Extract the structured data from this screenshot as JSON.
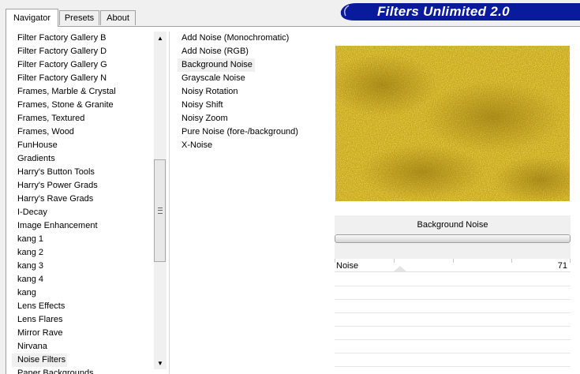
{
  "tabs": [
    {
      "label": "Navigator",
      "active": true
    },
    {
      "label": "Presets",
      "active": false
    },
    {
      "label": "About",
      "active": false
    }
  ],
  "banner": {
    "title": "Filters Unlimited 2.0",
    "color": "#0a1a9c"
  },
  "categories": [
    "Filter Factory Gallery B",
    "Filter Factory Gallery D",
    "Filter Factory Gallery G",
    "Filter Factory Gallery N",
    "Frames, Marble & Crystal",
    "Frames, Stone & Granite",
    "Frames, Textured",
    "Frames, Wood",
    "FunHouse",
    "Gradients",
    "Harry's Button Tools",
    "Harry's Power Grads",
    "Harry's Rave Grads",
    "I-Decay",
    "Image Enhancement",
    "kang 1",
    "kang 2",
    "kang 3",
    "kang 4",
    "kang",
    "Lens Effects",
    "Lens Flares",
    "Mirror Rave",
    "Nirvana",
    "Noise Filters",
    "Paper Backgrounds"
  ],
  "selected_category": "Noise Filters",
  "filters": [
    "Add Noise (Monochromatic)",
    "Add Noise (RGB)",
    "Background Noise",
    "Grayscale Noise",
    "Noisy Rotation",
    "Noisy Shift",
    "Noisy Zoom",
    "Pure Noise (fore-/background)",
    "X-Noise"
  ],
  "selected_filter": "Background Noise",
  "filter_name": "Background Noise",
  "parameter": {
    "label": "Noise",
    "value": "71"
  },
  "preview_colors": {
    "base": "#c9a814",
    "light": "#ecd73a",
    "dark": "#9a7a0c"
  }
}
